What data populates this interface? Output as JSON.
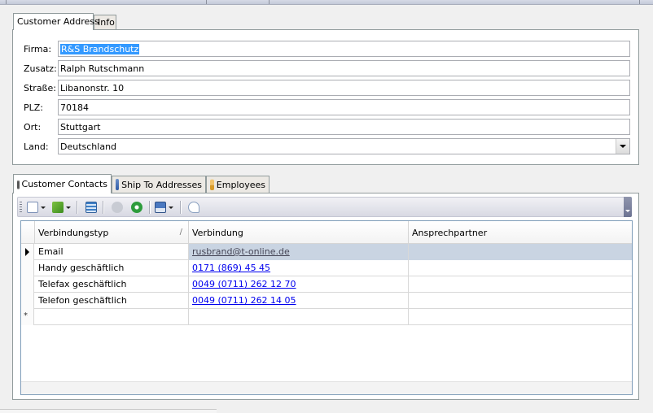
{
  "address_tabs": [
    {
      "label": "Customer Address",
      "active": true
    },
    {
      "label": "Info",
      "active": false
    }
  ],
  "address": {
    "firma": {
      "label": "Firma:",
      "value": "R&S Brandschutz"
    },
    "zusatz": {
      "label": "Zusatz:",
      "value": "Ralph Rutschmann"
    },
    "strasse": {
      "label": "Straße:",
      "value": "Libanonstr. 10"
    },
    "plz": {
      "label": "PLZ:",
      "value": "70184"
    },
    "ort": {
      "label": "Ort:",
      "value": "Stuttgart"
    },
    "land": {
      "label": "Land:",
      "value": "Deutschland"
    }
  },
  "detail_tabs": [
    {
      "label": "Customer Contacts",
      "active": true,
      "icon": "telephone-icon"
    },
    {
      "label": "Ship To Addresses",
      "active": false,
      "icon": "truck-icon"
    },
    {
      "label": "Employees",
      "active": false,
      "icon": "person-icon"
    }
  ],
  "toolbar_icons": [
    "new-icon",
    "add-icon",
    "grid-icon",
    "record-icon",
    "download-icon",
    "save-icon",
    "preview-icon"
  ],
  "grid": {
    "columns": [
      "Verbindungstyp",
      "Verbindung",
      "Ansprechpartner"
    ],
    "sort_marker": "/",
    "rows": [
      {
        "typ": "Email",
        "verbindung": "rusbrand@t-online.de",
        "ansprechpartner": ""
      },
      {
        "typ": "Handy geschäftlich",
        "verbindung": "0171 (869) 45 45",
        "ansprechpartner": ""
      },
      {
        "typ": "Telefax geschäftlich",
        "verbindung": "0049 (0711) 262 12 70",
        "ansprechpartner": ""
      },
      {
        "typ": "Telefon geschäftlich",
        "verbindung": "0049 (0711) 262 14 05",
        "ansprechpartner": ""
      }
    ],
    "new_row_marker": "*"
  },
  "colors": {
    "selection": "#3399ff",
    "link": "#0000ee",
    "current_row": "#c9d4e2",
    "border": "#919b9c"
  }
}
